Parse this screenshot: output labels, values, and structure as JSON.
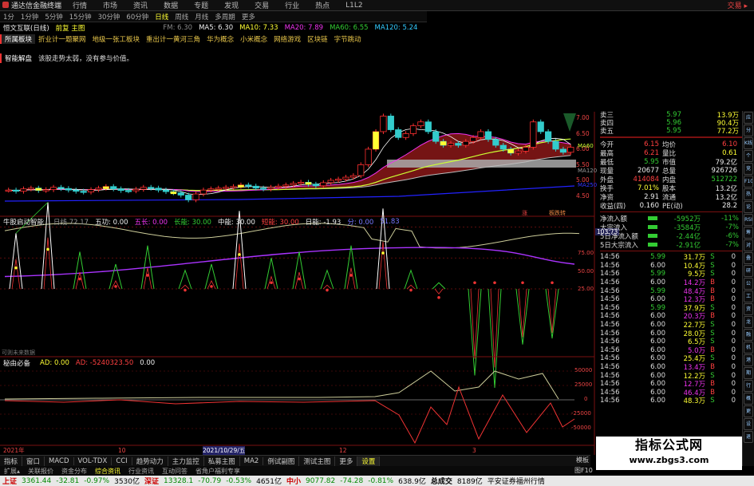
{
  "topbar": {
    "app_title": "通达信金融终端",
    "menus": [
      "行情",
      "市场",
      "资讯",
      "数据",
      "专题",
      "发现",
      "交易",
      "行业",
      "热点",
      "L1L2"
    ],
    "right": "交易 ▸"
  },
  "periods": {
    "items": [
      "1分",
      "1分钟",
      "5分钟",
      "15分钟",
      "30分钟",
      "60分钟",
      "日线",
      "周线",
      "月线",
      "多周期",
      "更多"
    ],
    "active_index": 6
  },
  "title": {
    "stock": "恒文互联(日线)",
    "mode": "前复 主图",
    "fm": "FM: 6.30",
    "ma5": "MA5: 6.30",
    "ma10": "MA10: 7.33",
    "ma20": "MA20: 7.89",
    "ma60": "MA60: 6.55",
    "ma120": "MA120: 5.24"
  },
  "concepts": {
    "tag": "所属板块",
    "items": [
      "折业计一题聚网",
      "地级一张工板块",
      "重出计一黄河三角",
      "华为概念",
      "小米概念",
      "网络游戏",
      "区块链",
      "字节跳动"
    ]
  },
  "smart": {
    "tag": "智能解盘",
    "text": "该股走势太弱，没有参与价值。"
  },
  "main_chart": {
    "right_axis": [
      "7.00",
      "6.50",
      "6.00",
      "5.50",
      "5.00",
      "4.50"
    ],
    "line_labels": {
      "ma60": "MA60",
      "ma120": "MA120",
      "ma250": "MA250"
    },
    "bottom_markers": [
      "涨",
      "板跌转"
    ],
    "price_path": [
      5.05,
      5.02,
      5.08,
      5.1,
      5.04,
      5.06,
      5.12,
      5.09,
      5.05,
      5.02,
      5.0,
      5.06,
      5.1,
      5.14,
      5.08,
      5.04,
      5.03,
      5.07,
      5.12,
      5.1,
      5.05,
      5.01,
      4.98,
      4.92,
      4.8,
      4.95,
      5.05,
      5.08,
      5.1,
      5.12,
      5.14,
      5.18,
      5.15,
      5.1,
      5.08,
      5.12,
      5.15,
      5.18,
      5.22,
      5.25,
      5.2,
      5.16,
      5.24,
      5.3,
      5.33,
      5.38,
      5.42,
      5.7,
      6.1,
      6.55,
      6.95,
      6.6,
      6.4,
      6.5,
      6.7,
      6.8,
      6.55,
      6.3,
      6.2,
      6.25,
      6.2,
      6.3,
      6.4,
      6.55,
      6.35,
      6.2,
      6.1,
      6.0,
      6.05,
      6.15,
      6.8,
      6.55,
      6.3,
      6.1,
      6.02,
      6.15
    ]
  },
  "indicator1": {
    "name": "牛股启动智能",
    "labels": [
      {
        "t": "日线 72.17",
        "c": "grey"
      },
      {
        "t": "五功: 0.00",
        "c": "white"
      },
      {
        "t": "五长: 0.00",
        "c": "magenta"
      },
      {
        "t": "长能: 30.00",
        "c": "green"
      },
      {
        "t": "中能: 30.00",
        "c": "white"
      },
      {
        "t": "短能: 30.00",
        "c": "red"
      },
      {
        "t": "日能: -1.93",
        "c": "white"
      },
      {
        "t": "分: 0.00",
        "c": "blue"
      },
      {
        "t": "51.83",
        "c": "blue"
      }
    ],
    "axis_top": "103.73",
    "axis": [
      "75.00",
      "50.00",
      "25.00"
    ],
    "footer": "可则未来数据"
  },
  "indicator2": {
    "name": "秘由必备",
    "labels": [
      {
        "t": "AD: 0.00",
        "c": "yellow"
      },
      {
        "t": "AD: -5240323.50",
        "c": "red"
      },
      {
        "t": "0.00",
        "c": "white"
      }
    ],
    "axis": [
      "50000",
      "25000",
      "0",
      "-25000",
      "-50000"
    ]
  },
  "dates": {
    "d1": "2021年",
    "d2": "10",
    "d3": "2021/10/29/五",
    "d4": "12",
    "d5": "3"
  },
  "quote": {
    "top_levels": [
      {
        "k": "卖三",
        "p": "5.97",
        "v": "13.9万"
      },
      {
        "k": "卖四",
        "p": "5.96",
        "v": "90.4万"
      },
      {
        "k": "卖五",
        "p": "5.95",
        "v": "77.2万"
      }
    ],
    "stats": [
      {
        "k1": "今开",
        "v1": "6.15",
        "k2": "均价",
        "v2": "6.10",
        "c1": "red",
        "c2": "red"
      },
      {
        "k1": "最高",
        "v1": "6.21",
        "k2": "量比",
        "v2": "0.61",
        "c1": "red",
        "c2": "yellow"
      },
      {
        "k1": "最低",
        "v1": "5.95",
        "k2": "市值",
        "v2": "79.2亿",
        "c1": "green",
        "c2": "white"
      },
      {
        "k1": "现量",
        "v1": "20677",
        "k2": "总量",
        "v2": "926726",
        "c1": "white",
        "c2": "white"
      },
      {
        "k1": "外盘",
        "v1": "414084",
        "k2": "内盘",
        "v2": "512722",
        "c1": "red",
        "c2": "green"
      },
      {
        "k1": "换手",
        "v1": "7.01%",
        "k2": "股本",
        "v2": "13.2亿",
        "c1": "yellow",
        "c2": "white"
      },
      {
        "k1": "净资",
        "v1": "2.91",
        "k2": "流通",
        "v2": "13.2亿",
        "c1": "white",
        "c2": "white"
      },
      {
        "k1": "收益(四)",
        "v1": "0.160",
        "k2": "PE(动)",
        "v2": "28.2",
        "c1": "white",
        "c2": "white"
      }
    ],
    "flows": [
      {
        "k": "净流入额",
        "v": "-5952万",
        "p": "-11%"
      },
      {
        "k": "大宗流入",
        "v": "-3584万",
        "p": "-7%"
      },
      {
        "k": "5日净流入额",
        "v": "-2.44亿",
        "p": "-6%"
      },
      {
        "k": "5日大宗流入",
        "v": "-2.91亿",
        "p": "-7%"
      }
    ],
    "ticks": [
      {
        "t": "14:56",
        "p": "5.99",
        "v": "31.7万",
        "s": "S"
      },
      {
        "t": "14:56",
        "p": "6.00",
        "v": "10.4万",
        "s": "S"
      },
      {
        "t": "14:56",
        "p": "5.99",
        "v": "9.5万",
        "s": "S"
      },
      {
        "t": "14:56",
        "p": "6.00",
        "v": "14.2万",
        "s": "B"
      },
      {
        "t": "14:56",
        "p": "5.99",
        "v": "48.4万",
        "s": "B"
      },
      {
        "t": "14:56",
        "p": "6.00",
        "v": "12.3万",
        "s": "B"
      },
      {
        "t": "14:56",
        "p": "5.99",
        "v": "37.9万",
        "s": "S"
      },
      {
        "t": "14:56",
        "p": "6.00",
        "v": "20.3万",
        "s": "B"
      },
      {
        "t": "14:56",
        "p": "6.00",
        "v": "22.7万",
        "s": "S"
      },
      {
        "t": "14:56",
        "p": "6.00",
        "v": "28.0万",
        "s": "S"
      },
      {
        "t": "14:56",
        "p": "6.00",
        "v": "6.5万",
        "s": "S"
      },
      {
        "t": "14:56",
        "p": "6.00",
        "v": "5.0万",
        "s": "B"
      },
      {
        "t": "14:56",
        "p": "6.00",
        "v": "25.4万",
        "s": "S"
      },
      {
        "t": "14:56",
        "p": "6.00",
        "v": "13.4万",
        "s": "B"
      },
      {
        "t": "14:56",
        "p": "6.00",
        "v": "12.2万",
        "s": "S"
      },
      {
        "t": "14:56",
        "p": "6.00",
        "v": "12.7万",
        "s": "B"
      },
      {
        "t": "14:56",
        "p": "6.00",
        "v": "46.4万",
        "s": "B"
      },
      {
        "t": "14:56",
        "p": "6.00",
        "v": "48.3万",
        "s": "S"
      }
    ]
  },
  "sidebar": [
    "应用",
    "分时",
    "K线",
    "个股",
    "竞价",
    "F10",
    "热点",
    "论股",
    "RSI",
    "筹码",
    "对比",
    "叠加",
    "研报",
    "公告",
    "工具",
    "资金",
    "龙虎",
    "融资",
    "机构",
    "港股",
    "期权",
    "行业",
    "概念",
    "更多",
    "设置",
    "退出"
  ],
  "tabs": {
    "items": [
      "指标",
      "窗口",
      "MACD",
      "VOL-TDX",
      "CCI",
      "趋势动力",
      "主力监控",
      "私募主图",
      "MA2",
      "例试副图",
      "测试主图",
      "更多",
      "设置"
    ],
    "active_index": 12
  },
  "subtabs": [
    "扩展▴",
    "关联报价",
    "资金分布",
    "综合资讯",
    "行业资讯",
    "互动问答",
    "省角户福利专享"
  ],
  "right_labels": {
    "chip": "模板",
    "f10": "图F10"
  },
  "status": {
    "sh_name": "上证",
    "sh_val": "3361.44",
    "sh_chg": "-32.81",
    "sh_pct": "-0.97%",
    "sh_amt": "3530亿",
    "sz_name": "深证",
    "sz_val": "13328.1",
    "sz_chg": "-70.79",
    "sz_pct": "-0.53%",
    "sz_amt": "4651亿",
    "zx_name": "中小",
    "zx_val": "9077.82",
    "zx_chg": "-74.28",
    "zx_pct": "-0.81%",
    "zx_amt": "638.9亿",
    "total_name": "总成交",
    "total_amt": "8189亿",
    "broker": "平安证券福州行情"
  },
  "watermark": {
    "line1": "指标公式网",
    "line2": "www.zbgs3.com"
  }
}
